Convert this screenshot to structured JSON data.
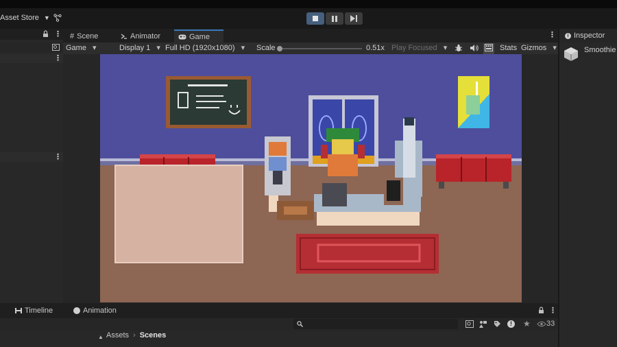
{
  "toolbar": {
    "asset_store_label": "Asset Store",
    "playback": [
      "stop",
      "pause",
      "step"
    ]
  },
  "scene_tabs": [
    {
      "label": "Scene",
      "icon": "hash-icon"
    },
    {
      "label": "Animator",
      "icon": "animator-icon"
    },
    {
      "label": "Game",
      "icon": "gamepad-icon",
      "active": true
    }
  ],
  "game_bar": {
    "view": "Game",
    "display": "Display 1",
    "resolution": "Full HD (1920x1080)",
    "scale_label": "Scale",
    "scale_value": "0.51x",
    "play_focused": "Play Focused",
    "stats": "Stats",
    "gizmos": "Gizmos"
  },
  "inspector": {
    "tab_label": "Inspector",
    "object_name": "Smoothie"
  },
  "bottom_tabs": [
    {
      "label": "Timeline",
      "icon": "timeline-icon"
    },
    {
      "label": "Animation",
      "icon": "animation-clock-icon"
    }
  ],
  "project": {
    "visibility_count": "33",
    "breadcrumb": [
      "Assets",
      "Scenes"
    ]
  },
  "colors": {
    "accent_blue": "#3a79bb",
    "wall": "#4e4e9c",
    "floor": "#8d6654",
    "rug": "#d6b2a2",
    "red_rug": "#b52e33"
  }
}
